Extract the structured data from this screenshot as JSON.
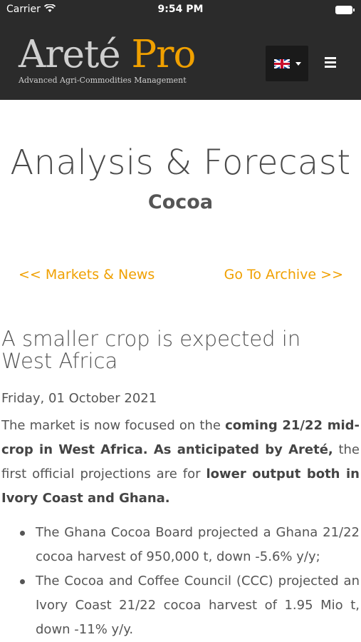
{
  "status_bar": {
    "carrier": "Carrier",
    "time": "9:54 PM"
  },
  "header": {
    "logo_arete": "Areté",
    "logo_pro": "Pro",
    "logo_tagline": "Advanced Agri-Commodities Management",
    "language": "en-GB",
    "colors": {
      "bar": "#2b2b2b",
      "accent": "#f0a000"
    }
  },
  "page": {
    "title": "Analysis & Forecast",
    "subtitle": "Cocoa"
  },
  "nav": {
    "back_label": "<< Markets & News",
    "archive_label": "Go To Archive >>"
  },
  "article": {
    "headline": "A smaller crop is expected in West Africa",
    "date": "Friday, 01 October 2021",
    "intro_1": "The market is now focused on the ",
    "intro_2": "coming 21/22 mid-crop in West Africa. As anticipated by Areté,",
    "intro_3": " the first official projections are for ",
    "intro_4": "lower output both in Ivory Coast and Ghana.",
    "bullets": [
      "The Ghana Cocoa Board projected a Ghana 21/22 cocoa harvest of 950,000 t, down -5.6% y/y;",
      "The Cocoa and Coffee Council (CCC) projected an Ivory Coast 21/22 cocoa harvest of 1.95 Mio t, down -11% y/y."
    ]
  }
}
